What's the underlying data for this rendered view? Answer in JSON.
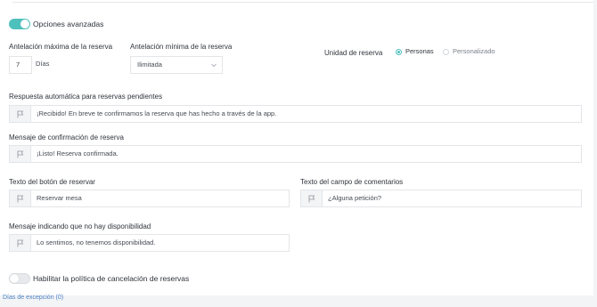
{
  "advanced": {
    "label": "Opciones avanzadas",
    "enabled": true
  },
  "max_advance": {
    "label": "Antelación máxima de la reserva",
    "value": "7",
    "unit": "Días"
  },
  "min_advance": {
    "label": "Antelación mínima de la reserva",
    "value": "Ilimitada"
  },
  "reservation_unit": {
    "label": "Unidad de reserva",
    "options": [
      {
        "label": "Personas",
        "selected": true
      },
      {
        "label": "Personalizado",
        "selected": false
      }
    ]
  },
  "auto_reply": {
    "label": "Respuesta automática para reservas pendientes",
    "value": "¡Recibido! En breve te confirmamos la reserva que has hecho a través de la app."
  },
  "confirmation": {
    "label": "Mensaje de confirmación de reserva",
    "value": "¡Listo! Reserva confirmada."
  },
  "reserve_button": {
    "label": "Texto del botón de reservar",
    "value": "Reservar mesa"
  },
  "comments_field": {
    "label": "Texto del campo de comentarios",
    "value": "¿Alguna petición?"
  },
  "no_availability": {
    "label": "Mensaje indicando que no hay disponibilidad",
    "value": "Lo sentimos, no tenemos disponibilidad."
  },
  "cancellation_policy": {
    "label": "Habilitar la política de cancelación de reservas",
    "enabled": false
  },
  "exception_days": {
    "label": "Días de excepción (0)"
  },
  "colors": {
    "accent": "#4fc1bd",
    "link": "#4a7fc1"
  }
}
